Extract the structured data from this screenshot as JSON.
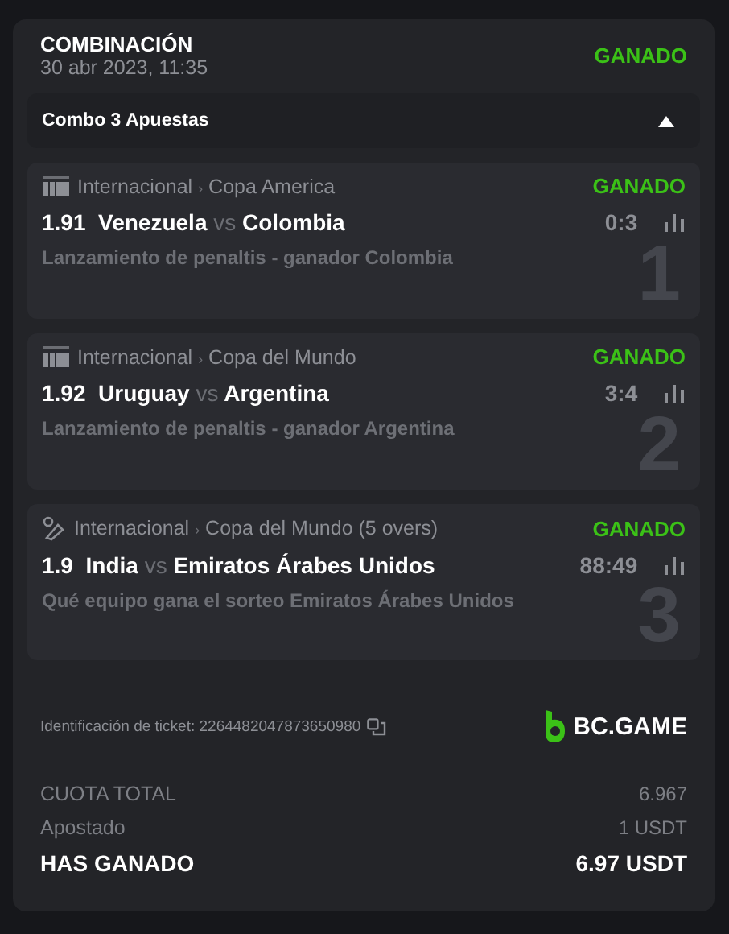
{
  "header": {
    "title": "COMBINACIÓN",
    "date": "30 abr 2023, 11:35",
    "status": "GANADO"
  },
  "combo": {
    "label": "Combo 3 Apuestas",
    "expanded": true
  },
  "bets": [
    {
      "kind": "fifa",
      "category": "Internacional",
      "separator": "›",
      "league": "Copa America",
      "status": "GANADO",
      "odds": "1.91",
      "home": "Venezuela",
      "vs": "vs",
      "away": "Colombia",
      "score": "0:3",
      "market": "Lanzamiento de penaltis - ganador Colombia",
      "number": "1"
    },
    {
      "kind": "fifa",
      "category": "Internacional",
      "separator": "›",
      "league": "Copa del Mundo",
      "status": "GANADO",
      "odds": "1.92",
      "home": "Uruguay",
      "vs": "vs",
      "away": "Argentina",
      "score": "3:4",
      "market": "Lanzamiento de penaltis - ganador Argentina",
      "number": "2"
    },
    {
      "kind": "cricket",
      "category": "Internacional",
      "separator": "›",
      "league": "Copa del Mundo (5 overs)",
      "status": "GANADO",
      "odds": "1.9",
      "home": "India",
      "vs": "vs",
      "away": "Emiratos Árabes Unidos",
      "score": "88:49",
      "market": "Qué equipo gana el sorteo Emiratos Árabes Unidos",
      "number": "3"
    }
  ],
  "ticket": {
    "label": "Identificación de ticket: 2264482047873650980",
    "brand": "BC.GAME"
  },
  "totals": [
    {
      "kind": "muted",
      "label": "CUOTA TOTAL",
      "value": "6.967"
    },
    {
      "kind": "muted",
      "label": "Apostado",
      "value": "1 USDT"
    },
    {
      "kind": "strong",
      "label": "HAS GANADO",
      "value": "6.97 USDT"
    }
  ]
}
